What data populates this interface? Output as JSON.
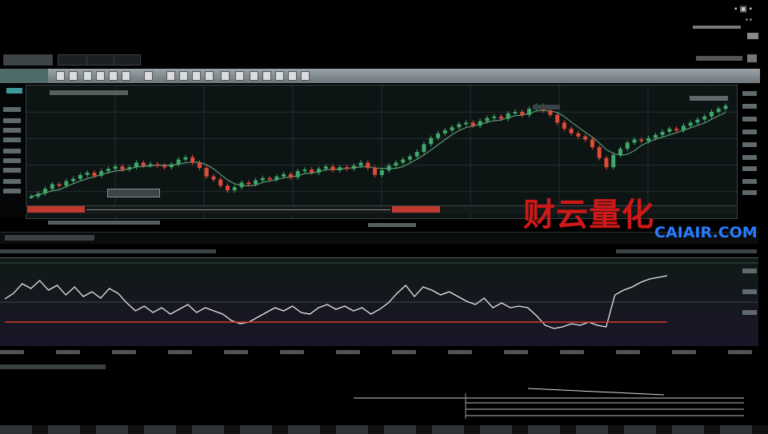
{
  "watermark": {
    "chinese": "财云量化",
    "english": "CAIAIR.COM"
  },
  "tabs": [
    "",
    "",
    "",
    ""
  ],
  "colors": {
    "candle_up": "#3fa86a",
    "candle_down": "#e04a3a",
    "ma_line": "#7fd0a0",
    "oscillator": "#e8e8e8",
    "signal_line": "#d43a2a",
    "background": "#000000"
  },
  "chart_data": [
    {
      "type": "line",
      "title": "",
      "xlabel": "",
      "ylabel": "",
      "series": [
        {
          "values": [
            22,
            26,
            32,
            38,
            36,
            42,
            45,
            50,
            53,
            49,
            55,
            58,
            61,
            57,
            60,
            66,
            62,
            64,
            62,
            60,
            64,
            70,
            73,
            66,
            59,
            48,
            44,
            36,
            30,
            34,
            40,
            38,
            43,
            46,
            44,
            48,
            51,
            47,
            55,
            57,
            53,
            58,
            61,
            56,
            60,
            58,
            62,
            66,
            59,
            50,
            56,
            62,
            66,
            70,
            74,
            80,
            90,
            98,
            104,
            108,
            112,
            116,
            118,
            114,
            120,
            124,
            126,
            123,
            130,
            132,
            128,
            136,
            140,
            134,
            128,
            118,
            110,
            104,
            100,
            96,
            86,
            72,
            60,
            76,
            84,
            92,
            96,
            94,
            98,
            102,
            106,
            110,
            108,
            114,
            118,
            122,
            126,
            132,
            136,
            140
          ]
        }
      ],
      "ylim": [
        0,
        160
      ]
    },
    {
      "type": "line",
      "title": "",
      "series": [
        {
          "values": [
            55,
            62,
            74,
            68,
            78,
            66,
            72,
            60,
            70,
            58,
            64,
            56,
            68,
            62,
            50,
            40,
            46,
            38,
            44,
            36,
            42,
            48,
            38,
            44,
            40,
            36,
            28,
            24,
            26,
            32,
            38,
            44,
            40,
            46,
            38,
            36,
            44,
            48,
            42,
            46,
            40,
            44,
            36,
            42,
            50,
            62,
            72,
            58,
            70,
            66,
            60,
            64,
            58,
            52,
            48,
            56,
            44,
            50,
            44,
            46,
            44,
            34,
            22,
            18,
            20,
            24,
            22,
            26,
            22,
            20,
            60,
            66,
            70,
            76,
            80,
            82,
            84
          ]
        },
        {
          "values": [
            26,
            26,
            26,
            26,
            26,
            26,
            26,
            26,
            26,
            26,
            26,
            26,
            26,
            26,
            26,
            26,
            26,
            26,
            26,
            26,
            26,
            26,
            26,
            26,
            26,
            26,
            26,
            26,
            26,
            26,
            26,
            26,
            26,
            26,
            26,
            26,
            26,
            26,
            26,
            26,
            26,
            26,
            26,
            26,
            26,
            26,
            26,
            26,
            26,
            26,
            26,
            26,
            26,
            26,
            26,
            26,
            26,
            26,
            26,
            26,
            26,
            26,
            26,
            26,
            26,
            26,
            26,
            26,
            26,
            26,
            26,
            26,
            26,
            26,
            26,
            26,
            26
          ]
        }
      ],
      "ylim": [
        0,
        100
      ]
    }
  ]
}
